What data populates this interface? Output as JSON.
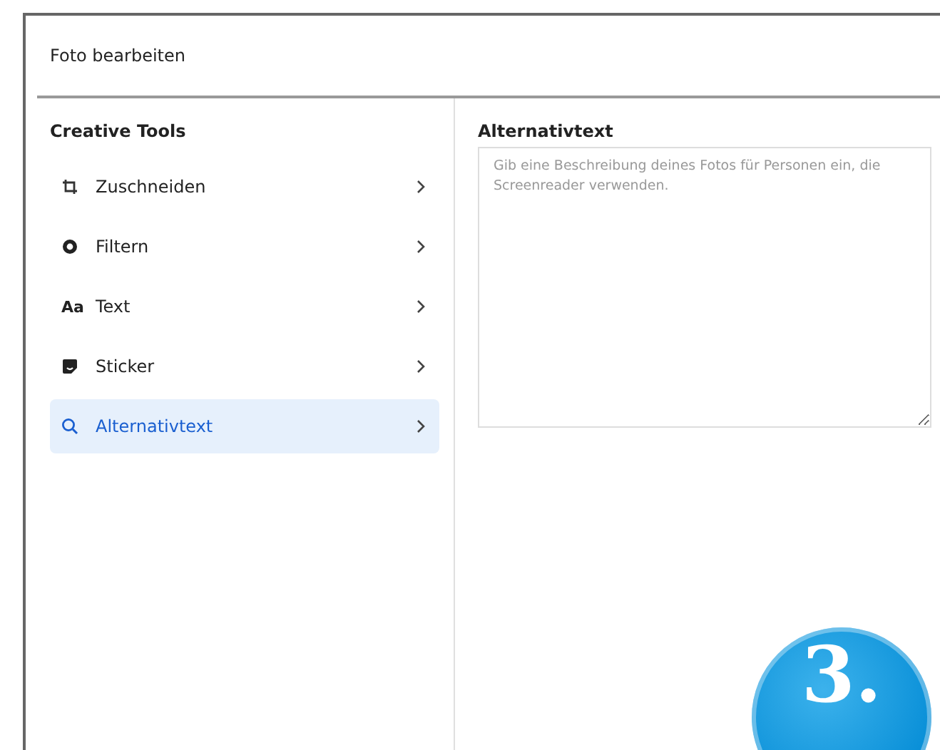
{
  "dialog": {
    "title": "Foto bearbeiten"
  },
  "sidebar": {
    "heading": "Creative Tools",
    "items": [
      {
        "label": "Zuschneiden",
        "kind": "crop",
        "selected": false
      },
      {
        "label": "Filtern",
        "kind": "filter",
        "selected": false
      },
      {
        "label": "Text",
        "kind": "glyph",
        "glyph": "Aa",
        "selected": false
      },
      {
        "label": "Sticker",
        "kind": "sticker",
        "selected": false
      },
      {
        "label": "Alternativtext",
        "kind": "search",
        "selected": true
      }
    ]
  },
  "alt_text": {
    "label": "Alternativtext",
    "placeholder": "Gib eine Beschreibung deines Fotos für Personen ein, die Screenreader verwenden."
  },
  "step_badge": "3."
}
